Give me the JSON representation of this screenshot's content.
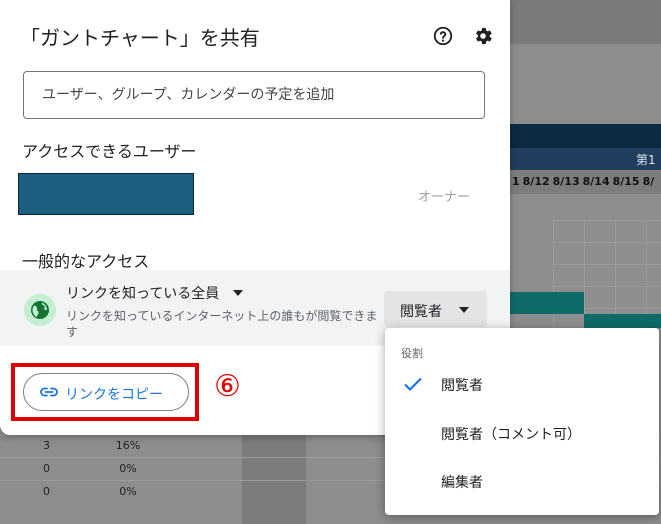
{
  "background": {
    "week_label": "第1",
    "dates": [
      "1",
      "8/12",
      "8/13",
      "8/14",
      "8/15",
      "8/"
    ],
    "rows": [
      {
        "count": "3",
        "percent": "16%"
      },
      {
        "count": "0",
        "percent": "0%"
      },
      {
        "count": "0",
        "percent": "0%"
      }
    ]
  },
  "dialog": {
    "title": "「ガントチャート」を共有",
    "help_icon": "help-circle-icon",
    "settings_icon": "gear-icon",
    "add_people_placeholder": "ユーザー、グループ、カレンダーの予定を追加",
    "access_heading": "アクセスできるユーザー",
    "owner_label": "オーナー",
    "general_access_heading": "一般的なアクセス",
    "link_scope": "リンクを知っている全員",
    "link_description": "リンクを知っているインターネット上の誰もが閲覧できます",
    "role_button": "閲覧者",
    "copy_link_button": "リンクをコピー",
    "annotation_step": "⑥"
  },
  "role_menu": {
    "header": "役割",
    "items": [
      {
        "label": "閲覧者",
        "selected": true
      },
      {
        "label": "閲覧者（コメント可）",
        "selected": false
      },
      {
        "label": "編集者",
        "selected": false
      }
    ]
  },
  "colors": {
    "accent": "#1a73e8",
    "annotation_red": "#e00000",
    "globe_bg": "#c4eed0",
    "redacted_user": "#1d5f7f"
  }
}
